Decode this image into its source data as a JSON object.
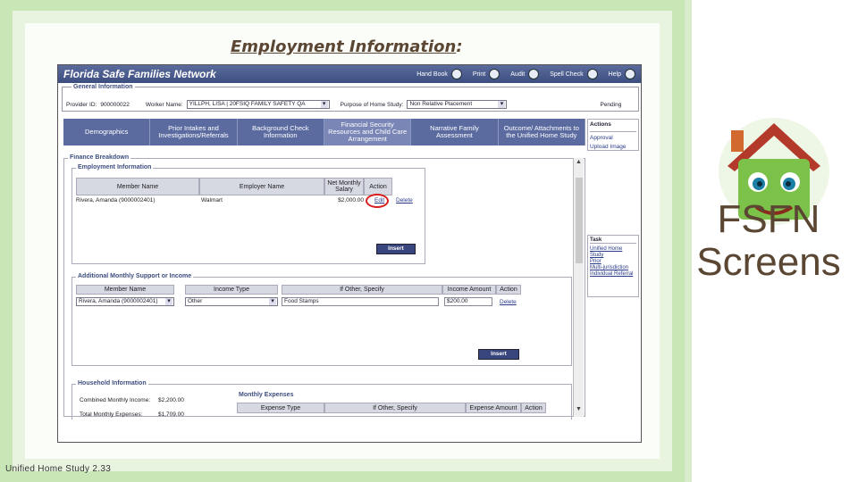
{
  "slide": {
    "title": "Employment Information",
    "title_colon": ":",
    "footer": "Unified Home Study 2.33",
    "side_text": "FSFN Screens"
  },
  "app": {
    "brand": "Florida Safe Families Network",
    "nav": [
      "Hand Book",
      "Print",
      "Audit",
      "Spell Check",
      "Help"
    ]
  },
  "general": {
    "legend": "General Information",
    "provider_label": "Provider ID:",
    "provider_id": "900000022",
    "worker_label": "Worker Name:",
    "worker_value": "YILLPH, LISA | 20FSIQ FAMILY SAFETY QA",
    "purpose_label": "Purpose of Home Study:",
    "purpose_value": "Non Relative Placement",
    "status": "Pending"
  },
  "tabs": [
    "Demographics",
    "Prior Intakes and Investigations/Referrals",
    "Background Check Information",
    "Financial Security Resources and Child Care Arrangement",
    "Narrative Family Assessment",
    "Outcome/ Attachments to the Unified Home Study"
  ],
  "actions": {
    "header": "Actions",
    "items": [
      "Approval",
      "Upload Image"
    ]
  },
  "tasks": {
    "header": "Task",
    "items": [
      "Unified Home Study",
      "Prior",
      "Multi-jurisdiction",
      "Individual Referral"
    ]
  },
  "finance": {
    "legend": "Finance Breakdown",
    "employment": {
      "legend": "Employment Information",
      "headers": [
        "Member Name",
        "Employer Name",
        "Net Monthly Salary",
        "Action"
      ],
      "row": {
        "member": "Rivera, Amanda (9000002401)",
        "employer": "Walmart",
        "salary": "$2,000.00",
        "edit": "Edit",
        "delete": "Delete"
      },
      "insert": "Insert"
    },
    "support": {
      "legend": "Additional Monthly Support or Income",
      "headers": [
        "Member Name",
        "Income Type",
        "If Other, Specify",
        "Income Amount",
        "Action"
      ],
      "row": {
        "member": "Rivera, Amanda (9000002401)",
        "type": "Other",
        "specify": "Food Stamps",
        "amount": "$200.00",
        "delete": "Delete"
      },
      "insert": "Insert"
    },
    "household": {
      "legend": "Household Information",
      "combined_label": "Combined Monthly Income:",
      "combined_value": "$2,200.00",
      "expenses_label": "Total Monthly Expenses:",
      "expenses_value": "$1,709.00",
      "monthly_legend": "Monthly Expenses",
      "headers": [
        "Expense Type",
        "If Other, Specify",
        "Expense Amount",
        "Action"
      ]
    }
  }
}
